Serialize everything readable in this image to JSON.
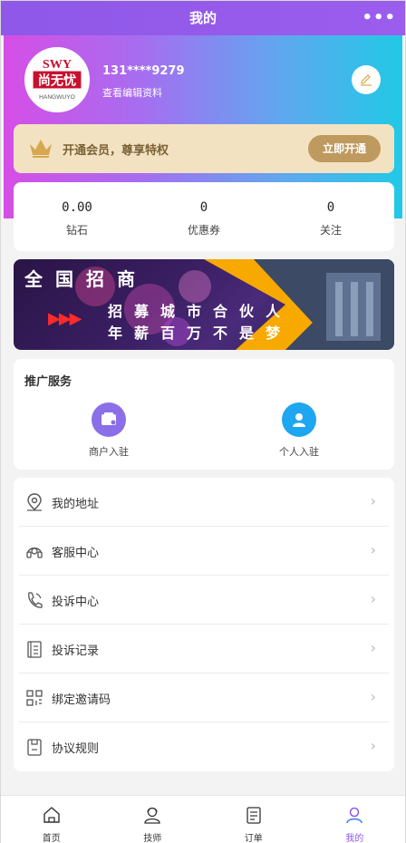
{
  "topbar": {
    "title": "我的",
    "more": "•••"
  },
  "profile": {
    "avatar_text_top": "SWY",
    "avatar_text_mid": "尚无忧",
    "avatar_text_arc": "HANGWUYO",
    "phone": "131****9279",
    "edit_link": "查看编辑资料"
  },
  "vip": {
    "text": "开通会员，尊享特权",
    "button": "立即开通"
  },
  "stats": [
    {
      "value": "0.00",
      "label": "钻石"
    },
    {
      "value": "0",
      "label": "优惠券"
    },
    {
      "value": "0",
      "label": "关注"
    }
  ],
  "banner": {
    "line1": "全国招商",
    "line2": "招募城市合伙人",
    "line3": "年薪百万不是梦",
    "arrows": "▶▶▶"
  },
  "promo": {
    "title": "推广服务",
    "items": [
      {
        "label": "商户入驻",
        "icon": "merchant-icon",
        "color": "#8a6fe8"
      },
      {
        "label": "个人入驻",
        "icon": "person-icon",
        "color": "#1ea6f0"
      }
    ]
  },
  "menu": [
    {
      "label": "我的地址",
      "icon": "location-icon"
    },
    {
      "label": "客服中心",
      "icon": "headset-icon"
    },
    {
      "label": "投诉中心",
      "icon": "phone-icon"
    },
    {
      "label": "投诉记录",
      "icon": "record-icon"
    },
    {
      "label": "绑定邀请码",
      "icon": "qrcode-icon"
    },
    {
      "label": "协议规则",
      "icon": "document-icon"
    }
  ],
  "chevron": "›",
  "tabs": [
    {
      "label": "首页",
      "icon": "home-icon"
    },
    {
      "label": "技师",
      "icon": "technician-icon"
    },
    {
      "label": "订单",
      "icon": "order-icon"
    },
    {
      "label": "我的",
      "icon": "profile-icon",
      "active": true
    }
  ],
  "colors": {
    "accent": "#8f58e8",
    "vip_gold": "#bf9a5f",
    "vip_bg": "#f3e2c2"
  }
}
